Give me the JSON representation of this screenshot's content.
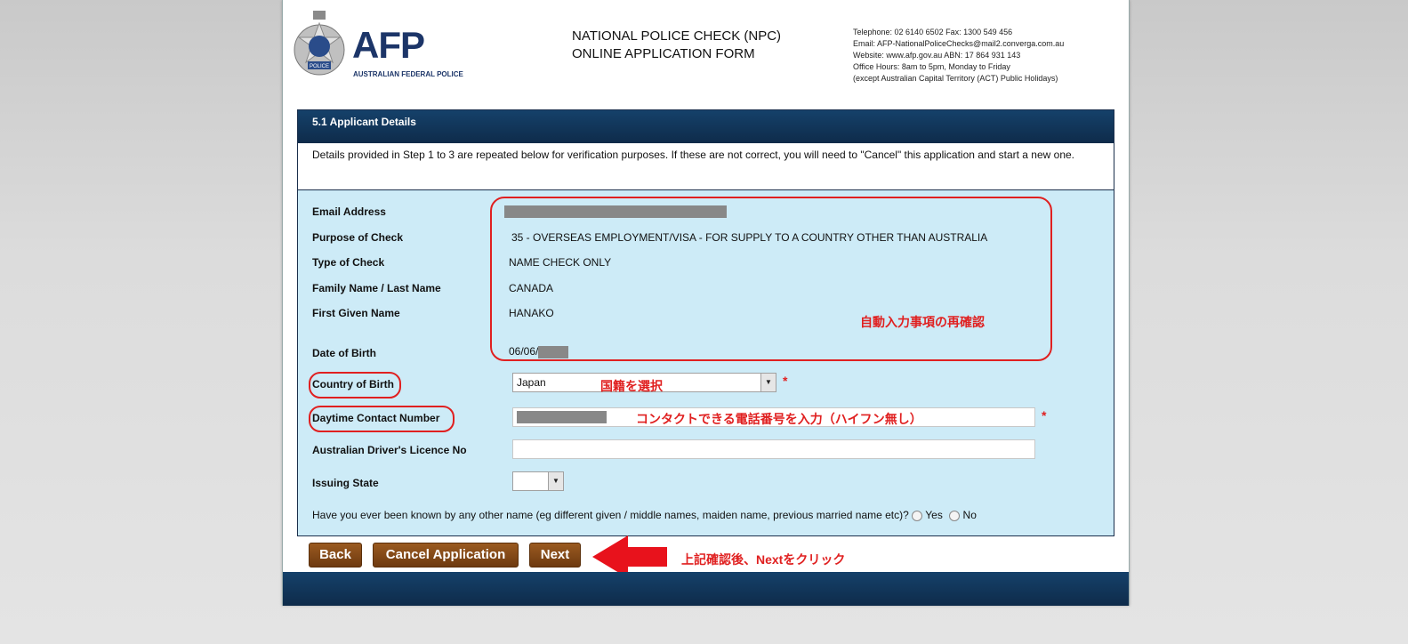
{
  "header": {
    "logo_text": "AFP",
    "logo_subtitle": "AUSTRALIAN FEDERAL POLICE",
    "crest_label": "POLICE",
    "form_title_line1": "NATIONAL POLICE CHECK (NPC)",
    "form_title_line2": "ONLINE APPLICATION FORM",
    "contact_line1": "Telephone: 02 6140 6502   Fax: 1300 549 456",
    "contact_line2": "Email: AFP-NationalPoliceChecks@mail2.converga.com.au",
    "contact_line3": "Website: www.afp.gov.au    ABN: 17 864 931 143",
    "contact_line4": "Office Hours: 8am to 5pm, Monday to Friday",
    "contact_line5": "(except Australian Capital Territory (ACT) Public Holidays)"
  },
  "panel": {
    "title": "5.1 Applicant Details",
    "intro": "Details provided in Step 1 to 3 are repeated below for verification purposes. If these are not correct, you will need to \"Cancel\" this application and start a new one."
  },
  "fields": {
    "email_label": "Email Address",
    "purpose_label": "Purpose of Check",
    "purpose_value": "35 - OVERSEAS EMPLOYMENT/VISA - FOR SUPPLY TO A COUNTRY OTHER THAN AUSTRALIA",
    "type_label": "Type of Check",
    "type_value": "NAME CHECK ONLY",
    "family_label": "Family Name / Last Name",
    "family_value": "CANADA",
    "given_label": "First Given Name",
    "given_value": "HANAKO",
    "dob_label": "Date of Birth",
    "dob_value": "06/06/",
    "country_label": "Country of Birth",
    "country_value": "Japan",
    "phone_label": "Daytime Contact Number",
    "licence_label": "Australian Driver's Licence No",
    "state_label": "Issuing State",
    "state_value": "",
    "othername_question": "Have you ever been known by any other name (eg different given / middle names, maiden name, previous married name etc)?",
    "yes_label": "Yes",
    "no_label": "No",
    "required_mark": "*"
  },
  "annotations": {
    "auto_confirm": "自動入力事項の再確認",
    "select_country": "国籍を選択",
    "enter_phone": "コンタクトできる電話番号を入力（ハイフン無し）",
    "click_next": "上記確認後、Nextをクリック"
  },
  "buttons": {
    "back": "Back",
    "cancel": "Cancel Application",
    "next": "Next"
  },
  "colors": {
    "header_bar": "#15416a",
    "panel_bg": "#cdebf7",
    "button_brown": "#8a4c18",
    "annotation_red": "#e02020",
    "logo_blue": "#1c3568"
  }
}
